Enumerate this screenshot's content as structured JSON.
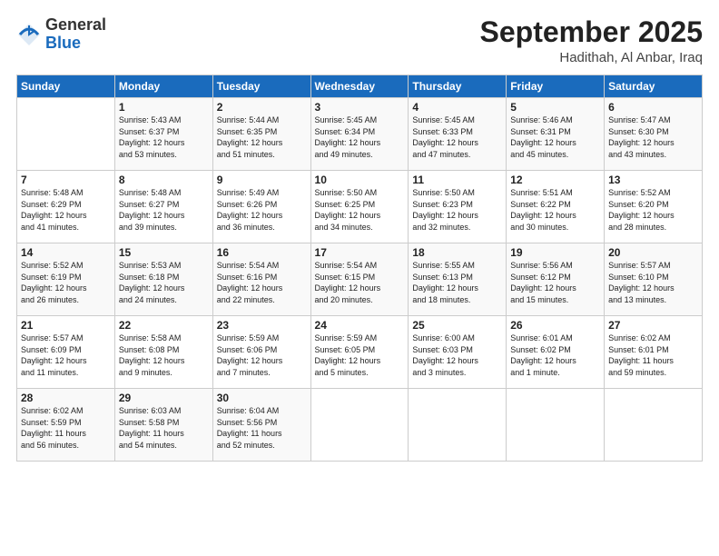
{
  "logo": {
    "general": "General",
    "blue": "Blue"
  },
  "title": "September 2025",
  "location": "Hadithah, Al Anbar, Iraq",
  "days_of_week": [
    "Sunday",
    "Monday",
    "Tuesday",
    "Wednesday",
    "Thursday",
    "Friday",
    "Saturday"
  ],
  "weeks": [
    [
      {
        "day": "",
        "info": ""
      },
      {
        "day": "1",
        "info": "Sunrise: 5:43 AM\nSunset: 6:37 PM\nDaylight: 12 hours\nand 53 minutes."
      },
      {
        "day": "2",
        "info": "Sunrise: 5:44 AM\nSunset: 6:35 PM\nDaylight: 12 hours\nand 51 minutes."
      },
      {
        "day": "3",
        "info": "Sunrise: 5:45 AM\nSunset: 6:34 PM\nDaylight: 12 hours\nand 49 minutes."
      },
      {
        "day": "4",
        "info": "Sunrise: 5:45 AM\nSunset: 6:33 PM\nDaylight: 12 hours\nand 47 minutes."
      },
      {
        "day": "5",
        "info": "Sunrise: 5:46 AM\nSunset: 6:31 PM\nDaylight: 12 hours\nand 45 minutes."
      },
      {
        "day": "6",
        "info": "Sunrise: 5:47 AM\nSunset: 6:30 PM\nDaylight: 12 hours\nand 43 minutes."
      }
    ],
    [
      {
        "day": "7",
        "info": "Sunrise: 5:48 AM\nSunset: 6:29 PM\nDaylight: 12 hours\nand 41 minutes."
      },
      {
        "day": "8",
        "info": "Sunrise: 5:48 AM\nSunset: 6:27 PM\nDaylight: 12 hours\nand 39 minutes."
      },
      {
        "day": "9",
        "info": "Sunrise: 5:49 AM\nSunset: 6:26 PM\nDaylight: 12 hours\nand 36 minutes."
      },
      {
        "day": "10",
        "info": "Sunrise: 5:50 AM\nSunset: 6:25 PM\nDaylight: 12 hours\nand 34 minutes."
      },
      {
        "day": "11",
        "info": "Sunrise: 5:50 AM\nSunset: 6:23 PM\nDaylight: 12 hours\nand 32 minutes."
      },
      {
        "day": "12",
        "info": "Sunrise: 5:51 AM\nSunset: 6:22 PM\nDaylight: 12 hours\nand 30 minutes."
      },
      {
        "day": "13",
        "info": "Sunrise: 5:52 AM\nSunset: 6:20 PM\nDaylight: 12 hours\nand 28 minutes."
      }
    ],
    [
      {
        "day": "14",
        "info": "Sunrise: 5:52 AM\nSunset: 6:19 PM\nDaylight: 12 hours\nand 26 minutes."
      },
      {
        "day": "15",
        "info": "Sunrise: 5:53 AM\nSunset: 6:18 PM\nDaylight: 12 hours\nand 24 minutes."
      },
      {
        "day": "16",
        "info": "Sunrise: 5:54 AM\nSunset: 6:16 PM\nDaylight: 12 hours\nand 22 minutes."
      },
      {
        "day": "17",
        "info": "Sunrise: 5:54 AM\nSunset: 6:15 PM\nDaylight: 12 hours\nand 20 minutes."
      },
      {
        "day": "18",
        "info": "Sunrise: 5:55 AM\nSunset: 6:13 PM\nDaylight: 12 hours\nand 18 minutes."
      },
      {
        "day": "19",
        "info": "Sunrise: 5:56 AM\nSunset: 6:12 PM\nDaylight: 12 hours\nand 15 minutes."
      },
      {
        "day": "20",
        "info": "Sunrise: 5:57 AM\nSunset: 6:10 PM\nDaylight: 12 hours\nand 13 minutes."
      }
    ],
    [
      {
        "day": "21",
        "info": "Sunrise: 5:57 AM\nSunset: 6:09 PM\nDaylight: 12 hours\nand 11 minutes."
      },
      {
        "day": "22",
        "info": "Sunrise: 5:58 AM\nSunset: 6:08 PM\nDaylight: 12 hours\nand 9 minutes."
      },
      {
        "day": "23",
        "info": "Sunrise: 5:59 AM\nSunset: 6:06 PM\nDaylight: 12 hours\nand 7 minutes."
      },
      {
        "day": "24",
        "info": "Sunrise: 5:59 AM\nSunset: 6:05 PM\nDaylight: 12 hours\nand 5 minutes."
      },
      {
        "day": "25",
        "info": "Sunrise: 6:00 AM\nSunset: 6:03 PM\nDaylight: 12 hours\nand 3 minutes."
      },
      {
        "day": "26",
        "info": "Sunrise: 6:01 AM\nSunset: 6:02 PM\nDaylight: 12 hours\nand 1 minute."
      },
      {
        "day": "27",
        "info": "Sunrise: 6:02 AM\nSunset: 6:01 PM\nDaylight: 11 hours\nand 59 minutes."
      }
    ],
    [
      {
        "day": "28",
        "info": "Sunrise: 6:02 AM\nSunset: 5:59 PM\nDaylight: 11 hours\nand 56 minutes."
      },
      {
        "day": "29",
        "info": "Sunrise: 6:03 AM\nSunset: 5:58 PM\nDaylight: 11 hours\nand 54 minutes."
      },
      {
        "day": "30",
        "info": "Sunrise: 6:04 AM\nSunset: 5:56 PM\nDaylight: 11 hours\nand 52 minutes."
      },
      {
        "day": "",
        "info": ""
      },
      {
        "day": "",
        "info": ""
      },
      {
        "day": "",
        "info": ""
      },
      {
        "day": "",
        "info": ""
      }
    ]
  ]
}
